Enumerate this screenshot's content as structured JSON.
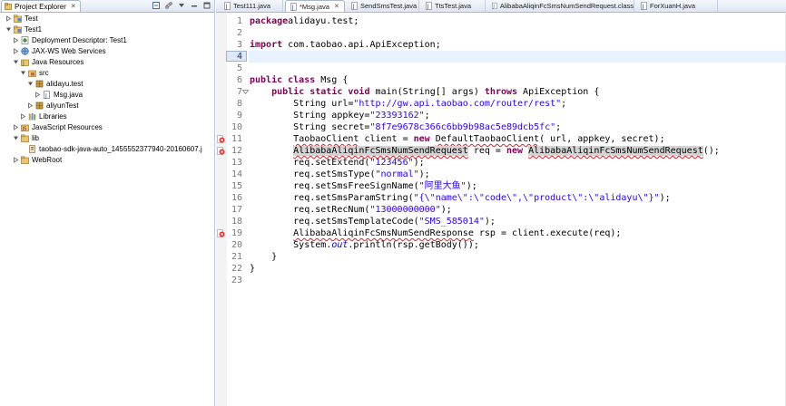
{
  "explorer": {
    "title": "Project Explorer",
    "tree": [
      {
        "label": "Test",
        "depth": 0,
        "twisty": "closed",
        "icon": "project-icon"
      },
      {
        "label": "Test1",
        "depth": 0,
        "twisty": "open",
        "icon": "project-icon"
      },
      {
        "label": "Deployment Descriptor: Test1",
        "depth": 1,
        "twisty": "closed",
        "icon": "descriptor-icon"
      },
      {
        "label": "JAX-WS Web Services",
        "depth": 1,
        "twisty": "closed",
        "icon": "webservices-icon"
      },
      {
        "label": "Java Resources",
        "depth": 1,
        "twisty": "open",
        "icon": "java-resources-icon"
      },
      {
        "label": "src",
        "depth": 2,
        "twisty": "open",
        "icon": "source-folder-icon"
      },
      {
        "label": "alidayu.test",
        "depth": 3,
        "twisty": "open",
        "icon": "package-icon"
      },
      {
        "label": "Msg.java",
        "depth": 4,
        "twisty": "closed",
        "icon": "java-file-icon"
      },
      {
        "label": "aliyunTest",
        "depth": 3,
        "twisty": "closed",
        "icon": "package-icon"
      },
      {
        "label": "Libraries",
        "depth": 2,
        "twisty": "closed",
        "icon": "library-icon"
      },
      {
        "label": "JavaScript Resources",
        "depth": 1,
        "twisty": "closed",
        "icon": "js-resources-icon"
      },
      {
        "label": "lib",
        "depth": 1,
        "twisty": "open",
        "icon": "folder-icon"
      },
      {
        "label": "taobao-sdk-java-auto_1455552377940-20160607.j",
        "depth": 2,
        "twisty": "none",
        "icon": "jar-file-icon"
      },
      {
        "label": "WebRoot",
        "depth": 1,
        "twisty": "closed",
        "icon": "folder-icon"
      }
    ]
  },
  "editor": {
    "tabs": [
      {
        "label": "Test111.java",
        "active": false
      },
      {
        "label": "*Msg.java",
        "active": true
      },
      {
        "label": "SendSmsTest.java",
        "active": false
      },
      {
        "label": "TtsTest.java",
        "active": false
      },
      {
        "label": "AlibabaAliqinFcSmsNumSendRequest.class",
        "active": false
      },
      {
        "label": "ForXuanH.java",
        "active": false
      }
    ],
    "current_line": 4,
    "lines": [
      {
        "n": "1",
        "marker": "",
        "parts": [
          [
            "kw",
            "package"
          ],
          [
            "",
            "alidayu.test;"
          ]
        ]
      },
      {
        "n": "2",
        "marker": "",
        "parts": []
      },
      {
        "n": "3",
        "marker": "",
        "parts": [
          [
            "kw",
            "import"
          ],
          [
            "",
            " com.taobao.api.ApiException;"
          ]
        ]
      },
      {
        "n": "4",
        "marker": "",
        "parts": []
      },
      {
        "n": "5",
        "marker": "",
        "parts": []
      },
      {
        "n": "6",
        "marker": "",
        "parts": [
          [
            "kw",
            "public class"
          ],
          [
            "",
            " Msg {"
          ]
        ]
      },
      {
        "n": "7",
        "marker": "fold",
        "parts": [
          [
            "",
            "    "
          ],
          [
            "kw",
            "public static void"
          ],
          [
            "",
            " main(String[] args) "
          ],
          [
            "kw",
            "throws"
          ],
          [
            "",
            " ApiException {"
          ]
        ]
      },
      {
        "n": "8",
        "marker": "",
        "parts": [
          [
            "",
            "        String url="
          ],
          [
            "str",
            "\"http://gw.api.taobao.com/router/rest\""
          ],
          [
            "",
            ";"
          ]
        ]
      },
      {
        "n": "9",
        "marker": "",
        "parts": [
          [
            "",
            "        String appkey="
          ],
          [
            "str",
            "\"23393162\""
          ],
          [
            "",
            ";"
          ]
        ]
      },
      {
        "n": "10",
        "marker": "",
        "parts": [
          [
            "",
            "        String secret="
          ],
          [
            "str",
            "\"8f7e9678c366c6bb9b98ac5e89dcb5fc\""
          ],
          [
            "",
            ";"
          ]
        ]
      },
      {
        "n": "11",
        "marker": "error",
        "parts": [
          [
            "",
            "        "
          ],
          [
            "err",
            "TaobaoClient"
          ],
          [
            "",
            " client = "
          ],
          [
            "kw",
            "new"
          ],
          [
            "",
            " "
          ],
          [
            "err",
            "DefaultTaobaoClient"
          ],
          [
            "",
            "( url, appkey, secret);"
          ]
        ]
      },
      {
        "n": "12",
        "marker": "error",
        "parts": [
          [
            "",
            "        "
          ],
          [
            "err hl",
            "AlibabaAliqinFcSmsNumSendRequest"
          ],
          [
            "",
            " req = "
          ],
          [
            "kw",
            "new"
          ],
          [
            "",
            " "
          ],
          [
            "err hl",
            "AlibabaAliqinFcSmsNumSendRequest"
          ],
          [
            "",
            "();"
          ]
        ]
      },
      {
        "n": "13",
        "marker": "",
        "parts": [
          [
            "",
            "        req.setExtend("
          ],
          [
            "str",
            "\"123456\""
          ],
          [
            "",
            ");"
          ]
        ]
      },
      {
        "n": "14",
        "marker": "",
        "parts": [
          [
            "",
            "        req.setSmsType("
          ],
          [
            "str",
            "\"normal\""
          ],
          [
            "",
            ");"
          ]
        ]
      },
      {
        "n": "15",
        "marker": "",
        "parts": [
          [
            "",
            "        req.setSmsFreeSignName("
          ],
          [
            "str",
            "\"阿里大鱼\""
          ],
          [
            "",
            ");"
          ]
        ]
      },
      {
        "n": "16",
        "marker": "",
        "parts": [
          [
            "",
            "        req.setSmsParamString("
          ],
          [
            "str",
            "\"{\\\"name\\\":\\\"code\\\",\\\"product\\\":\\\"alidayu\\\"}\""
          ],
          [
            "",
            ");"
          ]
        ]
      },
      {
        "n": "17",
        "marker": "",
        "parts": [
          [
            "",
            "        req.setRecNum("
          ],
          [
            "str",
            "\"13000000000\""
          ],
          [
            "",
            ");"
          ]
        ]
      },
      {
        "n": "18",
        "marker": "",
        "parts": [
          [
            "",
            "        req.setSmsTemplateCode("
          ],
          [
            "str",
            "\"SMS_585014\""
          ],
          [
            "",
            ");"
          ]
        ]
      },
      {
        "n": "19",
        "marker": "error",
        "parts": [
          [
            "",
            "        "
          ],
          [
            "err",
            "AlibabaAliqinFcSmsNumSendResponse"
          ],
          [
            "",
            " rsp = client.execute(req);"
          ]
        ]
      },
      {
        "n": "20",
        "marker": "",
        "parts": [
          [
            "",
            "        System."
          ],
          [
            "fld",
            "out"
          ],
          [
            "",
            ".println(rsp.getBody());"
          ]
        ]
      },
      {
        "n": "21",
        "marker": "",
        "parts": [
          [
            "",
            "    }"
          ]
        ]
      },
      {
        "n": "22",
        "marker": "",
        "parts": [
          [
            "",
            "}"
          ]
        ]
      },
      {
        "n": "23",
        "marker": "",
        "parts": []
      }
    ]
  },
  "colors": {
    "keyword": "#7f0055",
    "string": "#2a00ff",
    "static_field": "#0000c0",
    "error_underline": "#e0202a",
    "current_line": "#e8f2fe"
  }
}
